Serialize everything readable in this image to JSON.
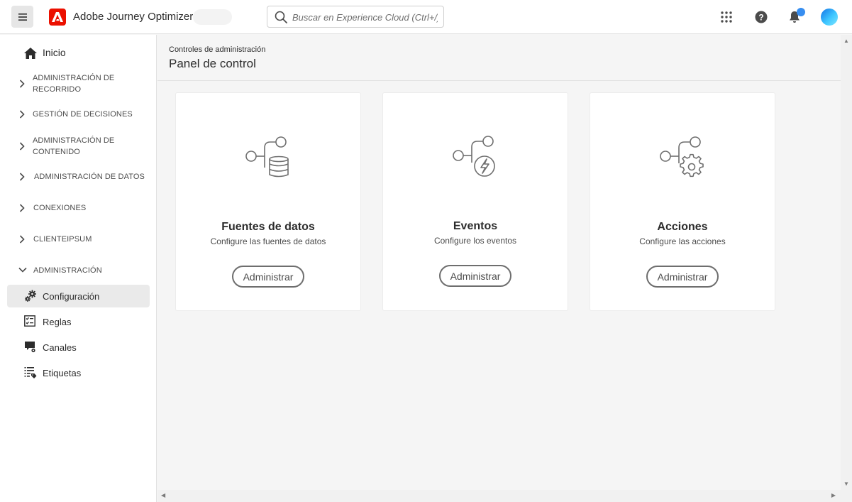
{
  "header": {
    "app_title": "Adobe Journey Optimizer",
    "search_placeholder": "Buscar en Experience Cloud (Ctrl+/)",
    "brand_color": "#eb1000",
    "notification_color": "#378ef0",
    "icons": [
      "menu-icon",
      "adobe-logo-icon",
      "search-icon",
      "apps-grid-icon",
      "help-icon",
      "bell-icon",
      "avatar"
    ]
  },
  "sidebar": {
    "home_label": "Inicio",
    "sections": [
      {
        "label_lines": [
          "ADMINISTRACIÓN DE",
          "RECORRIDO"
        ],
        "expanded": false
      },
      {
        "label_lines": [
          "GESTIÓN DE DECISIONES"
        ],
        "expanded": false
      },
      {
        "label_lines": [
          "ADMINISTRACIÓN DE",
          "CONTENIDO"
        ],
        "expanded": false
      },
      {
        "label_lines": [
          "ADMINISTRACIÓN DE DATOS"
        ],
        "expanded": false
      },
      {
        "label_lines": [
          "CONEXIONES"
        ],
        "expanded": false
      },
      {
        "label_lines": [
          "CLIENTEIPSUM"
        ],
        "expanded": false
      },
      {
        "label_lines": [
          "ADMINISTRACIÓN"
        ],
        "expanded": true
      }
    ],
    "sub_items": [
      {
        "label": "Configuración",
        "icon": "gears-icon",
        "active": true
      },
      {
        "label": "Reglas",
        "icon": "rules-icon",
        "active": false
      },
      {
        "label": "Canales",
        "icon": "channels-icon",
        "active": false
      },
      {
        "label": "Etiquetas",
        "icon": "tags-icon",
        "active": false
      }
    ]
  },
  "main": {
    "breadcrumb": "Controles de administración",
    "title": "Panel de control",
    "cards": [
      {
        "title": "Fuentes de datos",
        "description": "Configure las fuentes de datos",
        "button": "Administrar",
        "icon": "data-sources-icon"
      },
      {
        "title": "Eventos",
        "description": "Configure los eventos",
        "button": "Administrar",
        "icon": "events-icon"
      },
      {
        "title": "Acciones",
        "description": "Configure las acciones",
        "button": "Administrar",
        "icon": "actions-icon"
      }
    ]
  }
}
